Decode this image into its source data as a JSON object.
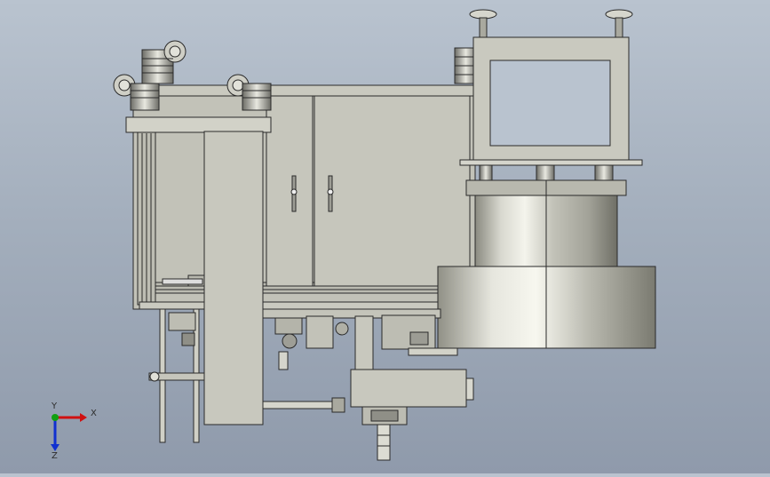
{
  "viewport": {
    "name": "cad-graphics-area",
    "background_top": "#b9c3cf",
    "background_bottom": "#8f9aab"
  },
  "colors": {
    "part_fill": "#c8c8be",
    "part_fill_dark": "#a9a99f",
    "edge": "#2a2a2a",
    "cylinder_light": "#f0f0e8",
    "cylinder_mid": "#bdbdb2",
    "cylinder_dark": "#77776d",
    "axis_x": "#d01010",
    "axis_y": "#10a010",
    "axis_z": "#1030d0"
  },
  "triad": {
    "x_label": "X",
    "y_label": "Y",
    "z_label": "Z"
  },
  "model_parts": [
    "frame-cabinet",
    "cabinet-door-left",
    "cabinet-door-right",
    "caster-wheel",
    "leveling-foot",
    "mount-bracket",
    "cylinder-large",
    "cylinder-upper",
    "vertical-column",
    "lower-mechanism"
  ]
}
